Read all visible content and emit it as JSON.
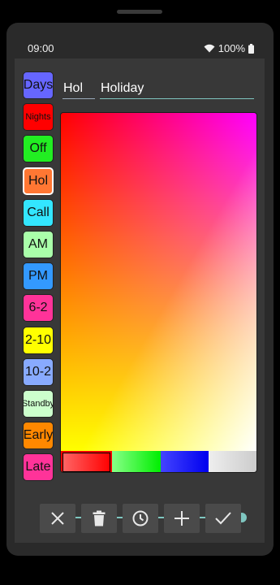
{
  "status": {
    "time": "09:00",
    "battery": "100%"
  },
  "shift": {
    "abbr": "Hol",
    "name": "Holiday"
  },
  "tags": [
    {
      "label": "Days",
      "color": "#6666ff",
      "small": false,
      "selected": false
    },
    {
      "label": "Nights",
      "color": "#ff0000",
      "small": true,
      "selected": false
    },
    {
      "label": "Off",
      "color": "#22ee22",
      "small": false,
      "selected": false
    },
    {
      "label": "Hol",
      "color": "#ff7733",
      "small": false,
      "selected": true
    },
    {
      "label": "Call",
      "color": "#33e6ff",
      "small": false,
      "selected": false
    },
    {
      "label": "AM",
      "color": "#aaffaa",
      "small": false,
      "selected": false
    },
    {
      "label": "PM",
      "color": "#3399ff",
      "small": false,
      "selected": false
    },
    {
      "label": "6-2",
      "color": "#ff3399",
      "small": false,
      "selected": false
    },
    {
      "label": "2-10",
      "color": "#ffff00",
      "small": false,
      "selected": false
    },
    {
      "label": "10-2",
      "color": "#88aaff",
      "small": false,
      "selected": false
    },
    {
      "label": "Standby",
      "color": "#ccffcc",
      "small": true,
      "selected": false
    },
    {
      "label": "Early",
      "color": "#ff8800",
      "small": false,
      "selected": false
    },
    {
      "label": "Late",
      "color": "#ff3399",
      "small": false,
      "selected": false
    }
  ],
  "picker": {
    "hue_start": "#ff0000",
    "hue_end": "#ff00ff"
  },
  "swatches": [
    {
      "name": "red",
      "color": "linear-gradient(to right,#ff6666,#ff0000)"
    },
    {
      "name": "green",
      "color": "linear-gradient(to right,#88ff88,#00ee00)"
    },
    {
      "name": "blue",
      "color": "linear-gradient(to right,#4444ff,#0000ee)"
    },
    {
      "name": "grey",
      "color": "linear-gradient(to right,#eeeeee,#cccccc)"
    }
  ],
  "slider": {
    "value": 1.0
  },
  "toolbar": [
    "close-icon",
    "trash-icon",
    "clock-icon",
    "plus-icon",
    "check-icon"
  ],
  "accent": "#7fc6c0"
}
